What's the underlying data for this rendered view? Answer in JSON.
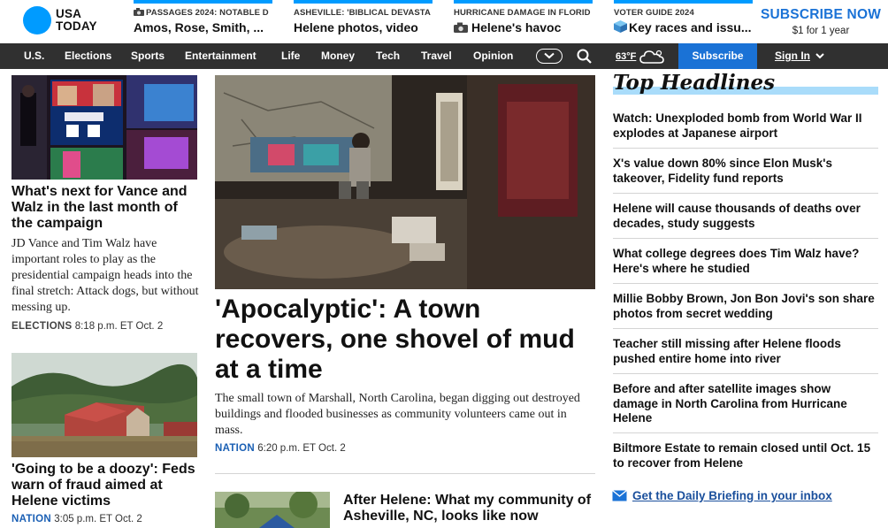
{
  "logo": {
    "line1": "USA",
    "line2": "TODAY"
  },
  "teasers": [
    {
      "kicker": "PASSAGES 2024: NOTABLE D",
      "title": "Amos, Rose, Smith, ...",
      "icon": "camera-icon"
    },
    {
      "kicker": "ASHEVILLE: 'BIBLICAL DEVASTA",
      "title": "Helene photos, video",
      "icon": ""
    },
    {
      "kicker": "HURRICANE DAMAGE IN FLORID",
      "title": "Helene's havoc",
      "icon": "camera-icon"
    },
    {
      "kicker": "VOTER GUIDE 2024",
      "title": "Key races and issu...",
      "icon": "ballot-box-icon"
    }
  ],
  "promo": {
    "title": "SUBSCRIBE NOW",
    "price": "$1 for 1 year"
  },
  "nav": {
    "items": [
      "U.S.",
      "Elections",
      "Sports",
      "Entertainment",
      "Life",
      "Money",
      "Tech",
      "Travel",
      "Opinion"
    ],
    "weather": "63°F",
    "subscribe": "Subscribe",
    "signin": "Sign In"
  },
  "left_stories": [
    {
      "title": "What's next for Vance and Walz in the last month of the campaign",
      "summary": "JD Vance and Tim Walz have important roles to play as the presidential campaign heads into the final stretch: Attack dogs, but without messing up.",
      "section": "ELECTIONS",
      "time": "8:18 p.m. ET Oct. 2"
    },
    {
      "title": "'Going to be a doozy': Feds warn of fraud aimed at Helene victims",
      "section": "NATION",
      "time": "3:05 p.m. ET Oct. 2"
    }
  ],
  "lead_story": {
    "title": "'Apocalyptic': A town recovers, one shovel of mud at a time",
    "summary": "The small town of Marshall, North Carolina, began digging out destroyed buildings and flooded businesses as community volunteers came out in mass.",
    "section": "NATION",
    "time": "6:20 p.m. ET Oct. 2"
  },
  "secondary_story": {
    "title": "After Helene: What my community of Asheville, NC, looks like now"
  },
  "top_headlines": {
    "heading": "Top Headlines",
    "items": [
      "Watch: Unexploded bomb from World War II explodes at Japanese airport",
      "X's value down 80% since Elon Musk's takeover, Fidelity fund reports",
      "Helene will cause thousands of deaths over decades, study suggests",
      "What college degrees does Tim Walz have? Here's where he studied",
      "Millie Bobby Brown, Jon Bon Jovi's son share photos from secret wedding",
      "Teacher still missing after Helene floods pushed entire home into river",
      "Before and after satellite images show damage in North Carolina from Hurricane Helene",
      "Biltmore Estate to remain closed until Oct. 15 to recover from Helene"
    ]
  },
  "briefing_link": "Get the Daily Briefing in your inbox",
  "colors": {
    "brand_blue": "#009bff",
    "link_blue": "#1a72d6",
    "nav_bg": "#303030",
    "headline_bar": "#a9dcfa"
  }
}
